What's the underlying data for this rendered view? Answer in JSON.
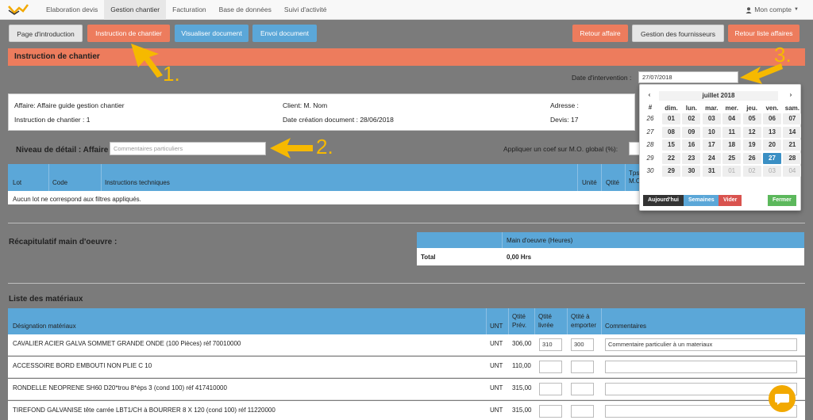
{
  "nav": {
    "tabs": [
      "Elaboration devis",
      "Gestion chantier",
      "Facturation",
      "Base de données",
      "Suivi d'activité"
    ],
    "account": "Mon compte"
  },
  "toolbar": {
    "intro": "Page d'introduction",
    "instruction": "Instruction de chantier",
    "visualiser": "Visualiser document",
    "envoi": "Envoi document",
    "retour_affaire": "Retour affaire",
    "fournisseurs": "Gestion des fournisseurs",
    "retour_liste": "Retour liste affaires"
  },
  "page": {
    "title": "Instruction de chantier",
    "date_label": "Date d'intervention :",
    "date_value": "27/07/2018"
  },
  "info": {
    "affaire": "Affaire: Affaire guide gestion chantier",
    "instruction": "Instruction de chantier : 1",
    "client": "Client: M. Nom",
    "date_creation": "Date création document : 28/06/2018",
    "adresse": "Adresse :",
    "devis": "Devis: 17"
  },
  "detail": {
    "label": "Niveau de détail : Affaire",
    "placeholder": "Commentaires particuliers",
    "coef_label": "Appliquer un coef sur M.O. global (%):"
  },
  "lots_table": {
    "headers": [
      "Lot",
      "Code",
      "Instructions techniques",
      "Unité",
      "Qtité",
      "Tps M.O."
    ],
    "empty": "Aucun lot ne correspond aux filtres appliqués."
  },
  "mo": {
    "title": "Récapitulatif main d'oeuvre :",
    "header": "Main d'oeuvre (Heures)",
    "total_label": "Total",
    "total_value": "0,00 Hrs"
  },
  "materiaux": {
    "title": "Liste des matériaux",
    "headers": {
      "designation": "Désignation matériaux",
      "unt": "UNT",
      "prev1": "Qtité",
      "prev2": "Prév.",
      "livree1": "Qtité",
      "livree2": "livrée",
      "emporter1": "Qtité à",
      "emporter2": "emporter",
      "commentaires": "Commentaires"
    },
    "rows": [
      {
        "designation": "CAVALIER ACIER GALVA SOMMET GRANDE ONDE (100 Pièces) réf 70010000",
        "unt": "UNT",
        "prev": "306,00",
        "livree": "310",
        "emporter": "300",
        "comment": "Commentaire particulier à un materiaux"
      },
      {
        "designation": "ACCESSOIRE BORD EMBOUTI NON PLIE C 10",
        "unt": "UNT",
        "prev": "110,00",
        "livree": "",
        "emporter": "",
        "comment": ""
      },
      {
        "designation": "RONDELLE NEOPRENE SH60 D20*trou 8*éps 3 (cond 100) réf 417410000",
        "unt": "UNT",
        "prev": "315,00",
        "livree": "",
        "emporter": "",
        "comment": ""
      },
      {
        "designation": "TIREFOND GALVANISE tête carrée LBT1/CH à BOURRER 8 X 120 (cond 100) réf 11220000",
        "unt": "UNT",
        "prev": "315,00",
        "livree": "",
        "emporter": "",
        "comment": ""
      }
    ]
  },
  "calendar": {
    "month": "juillet 2018",
    "week_col": "#",
    "days": [
      "dim.",
      "lun.",
      "mar.",
      "mer.",
      "jeu.",
      "ven.",
      "sam."
    ],
    "weeks": [
      {
        "wk": "26",
        "d": [
          "01",
          "02",
          "03",
          "04",
          "05",
          "06",
          "07"
        ]
      },
      {
        "wk": "27",
        "d": [
          "08",
          "09",
          "10",
          "11",
          "12",
          "13",
          "14"
        ]
      },
      {
        "wk": "28",
        "d": [
          "15",
          "16",
          "17",
          "18",
          "19",
          "20",
          "21"
        ]
      },
      {
        "wk": "29",
        "d": [
          "22",
          "23",
          "24",
          "25",
          "26",
          "27",
          "28"
        ]
      },
      {
        "wk": "30",
        "d": [
          "29",
          "30",
          "31",
          "01",
          "02",
          "03",
          "04"
        ]
      }
    ],
    "today": "Aujourd'hui",
    "semaines": "Semaines",
    "vider": "Vider",
    "fermer": "Fermer"
  },
  "annotations": [
    "1.",
    "2.",
    "3."
  ],
  "colors": {
    "accent_orange": "#ed7c5d",
    "accent_blue": "#5ba7d8",
    "selected_day": "#3a8fc4",
    "annotation": "#f6b900"
  }
}
